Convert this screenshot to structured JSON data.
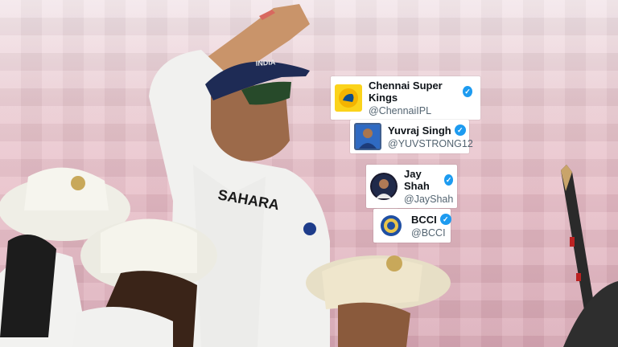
{
  "accounts": [
    {
      "name": "Chennai Super Kings",
      "handle": "@ChennaiIPL",
      "avatar": "csk-lion-logo-icon",
      "verified": true
    },
    {
      "name": "Yuvraj Singh",
      "handle": "@YUVSTRONG12",
      "avatar": "player-photo-avatar",
      "verified": true
    },
    {
      "name": "Jay Shah",
      "handle": "@JayShah",
      "avatar": "person-photo-avatar",
      "verified": true
    },
    {
      "name": "BCCI",
      "handle": "@BCCI",
      "avatar": "bcci-crest-icon",
      "verified": true
    }
  ],
  "photo": {
    "jersey_text": "SAHARA",
    "cap_text": "INDIA"
  },
  "colors": {
    "verified_blue": "#1d9bf0",
    "stand_pink": "#e7bcc6",
    "india_cap_navy": "#1e2b55"
  }
}
